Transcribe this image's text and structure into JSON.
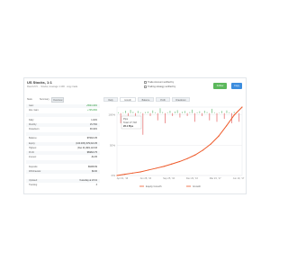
{
  "header": {
    "title": "US Stocks, 1:1",
    "subtitle": "Real 1/0.5 ... Stocks, leverage 1:100 · copy trade",
    "checks": [
      "Trade Account verified by",
      "Trading strategy verified by"
    ],
    "buttons": [
      "Follow",
      "Copy"
    ],
    "colors": {
      "follow": "#5cb85c",
      "copy": "#3c8dde"
    }
  },
  "left_tabs": [
    "Stats",
    "Summary",
    "Overview"
  ],
  "stats": [
    {
      "k": "Gain:",
      "v": "+5504.46%"
    },
    {
      "k": "Abs. Gain:",
      "v": "+745.29%"
    },
    {
      "k": "",
      "v": ""
    },
    {
      "k": "Daily:",
      "v": "1.02%"
    },
    {
      "k": "Monthly:",
      "v": "15.79%"
    },
    {
      "k": "Drawdown:",
      "v": "38.40%"
    },
    {
      "k": "",
      "v": ""
    },
    {
      "k": "Balance:",
      "v": "$79624.35"
    },
    {
      "k": "Equity:",
      "v": "(100.00%) $79,624.35"
    },
    {
      "k": "Highest:",
      "v": "(Dec 01) $81,124.93"
    },
    {
      "k": "Profit:",
      "v": "$69824.75"
    },
    {
      "k": "Interest:",
      "v": "-$1.05"
    },
    {
      "k": "",
      "v": ""
    },
    {
      "k": "Deposits:",
      "v": "$9499.99"
    },
    {
      "k": "Withdrawals:",
      "v": "$0.00"
    },
    {
      "k": "",
      "v": ""
    },
    {
      "k": "Updated:",
      "v": "Yesterday at 23:41"
    },
    {
      "k": "Tracking:",
      "v": "3"
    }
  ],
  "chart_tabs": [
    "Daily",
    "Growth",
    "Balance",
    "Profit",
    "Drawdown"
  ],
  "chart_data": {
    "type": "line",
    "y_ticks": [
      "100%",
      "50%",
      "0%"
    ],
    "x_ticks": [
      "Apr 01, '16",
      "Jun 28, '16",
      "Sep 25, '16",
      "Dec 23, '16",
      "Mar 23, '17",
      "Jun 19, '17"
    ],
    "legend": [
      "Equity Growth",
      "Growth"
    ],
    "tooltip": {
      "title": "Pips",
      "line1": "Total: 27,718",
      "line2": "26.1 Pips"
    },
    "colors": {
      "growth": "#ee5a2a",
      "bars_pos": "#7cc48a",
      "bars_neg": "#e87777"
    },
    "growth": [
      [
        0,
        0
      ],
      [
        10,
        2
      ],
      [
        20,
        4
      ],
      [
        30,
        6
      ],
      [
        40,
        9
      ],
      [
        50,
        12
      ],
      [
        60,
        15
      ],
      [
        70,
        19
      ],
      [
        80,
        23
      ],
      [
        90,
        28
      ],
      [
        100,
        34
      ],
      [
        110,
        42
      ],
      [
        120,
        52
      ],
      [
        130,
        65
      ],
      [
        140,
        82
      ],
      [
        150,
        100
      ],
      [
        160,
        113
      ]
    ]
  }
}
